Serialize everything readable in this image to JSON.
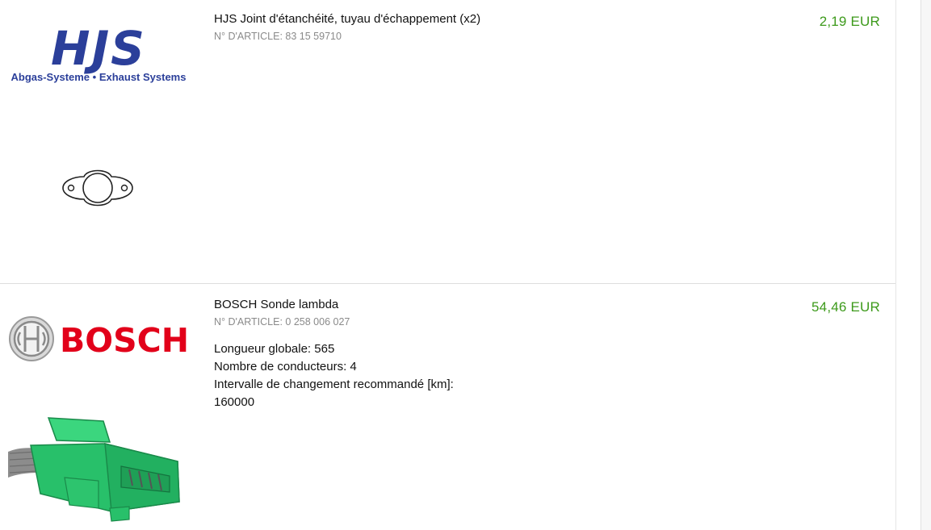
{
  "products": [
    {
      "brand_logo": {
        "name": "HJS",
        "tagline": "Abgas-Systeme • Exhaust Systems",
        "color": "#2b3f9a"
      },
      "image_icon": "exhaust-gasket-icon",
      "title": "HJS Joint d'étanchéité, tuyau d'échappement (x2)",
      "article_number": "N° D'ARTICLE: 83 15 59710",
      "price": "2,19 EUR",
      "specs": []
    },
    {
      "brand_logo": {
        "name": "BOSCH",
        "color": "#e2001a"
      },
      "image_icon": "lambda-sensor-connector-icon",
      "title": "BOSCH Sonde lambda",
      "article_number": "N° D'ARTICLE: 0 258 006 027",
      "price": "54,46 EUR",
      "specs": [
        "Longueur globale: 565",
        "Nombre de conducteurs: 4",
        "Intervalle de changement recommandé [km]:",
        "160000"
      ]
    }
  ],
  "colors": {
    "price": "#3d9a1b",
    "article_number": "#8a8a8a",
    "divider": "#dedede"
  }
}
